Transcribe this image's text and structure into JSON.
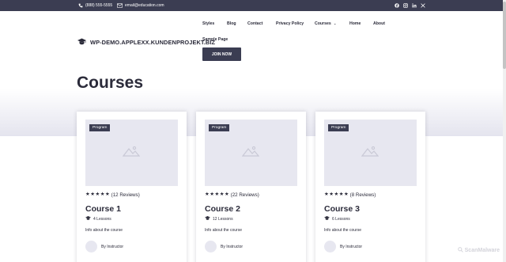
{
  "topbar": {
    "phone": "(888) 555-5555",
    "email": "email@education.com",
    "social_icons": [
      "facebook-icon",
      "instagram-icon",
      "linkedin-icon",
      "x-icon"
    ]
  },
  "site": {
    "logo_text": "WP-DEMO.APPLEXX.KUNDENPROJEKT.BIZ"
  },
  "nav": {
    "styles": "Styles",
    "blog": "Blog",
    "contact": "Contact",
    "privacy": "Privacy Policy",
    "courses": "Courses",
    "home": "Home",
    "about": "About",
    "sample": "Sample Page",
    "join": "JOIN NOW"
  },
  "page": {
    "title": "Courses"
  },
  "cards": [
    {
      "badge": "Program",
      "rating_text": "(12 Reviews)",
      "stars": 5,
      "title": "Course 1",
      "lessons": "4 Lessons",
      "info": "Info about the course",
      "instructor": "By Instructor"
    },
    {
      "badge": "Program",
      "rating_text": "(22 Reviews)",
      "stars": 5,
      "title": "Course 2",
      "lessons": "12 Lessons",
      "info": "Info about the course",
      "instructor": "By Instructor"
    },
    {
      "badge": "Program",
      "rating_text": "(8 Reviews)",
      "stars": 5,
      "title": "Course 3",
      "lessons": "6 Lessons",
      "info": "Info about the course",
      "instructor": "By Instructor"
    }
  ],
  "watermark": "ScanMalware",
  "colors": {
    "dark": "#3b3d52",
    "placeholder": "#e7e7f0"
  }
}
